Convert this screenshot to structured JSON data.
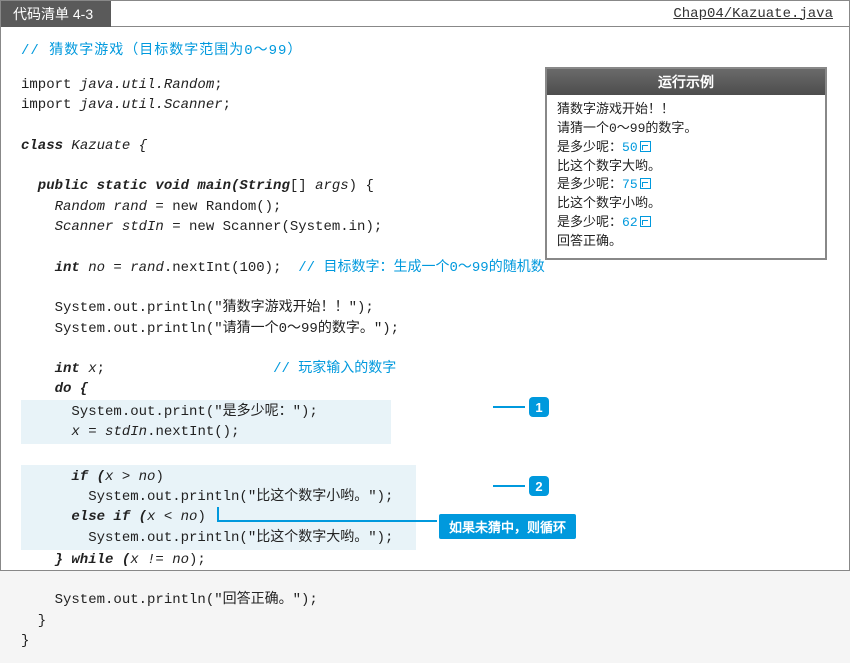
{
  "header": {
    "title_label": "代码清单 4-3",
    "file_path": "Chap04/Kazuate.java"
  },
  "top_comment": "//  猜数字游戏（目标数字范围为0～99）",
  "code": {
    "import1a": "import ",
    "import1b": "java.util.Random",
    "semi": ";",
    "import2b": "java.util.Scanner",
    "class_kw": "class",
    "class_name": " Kazuate {",
    "main_sig1": "  public static void main(String",
    "main_sig2": "[] ",
    "main_sig3": "args",
    "main_sig4": ") {",
    "rand_decl": "    Random rand",
    "rand_rest": " = new Random();",
    "scan_decl": "    Scanner stdIn",
    "scan_rest": " = new Scanner(System.in);",
    "no_decl": "    int ",
    "no_var": "no",
    "no_rest": " = ",
    "no_rand": "rand",
    "no_call": ".nextInt(100);  ",
    "no_cm": "// 目标数字：生成一个0～99的随机数",
    "out1": "    System.out.println(\"猜数字游戏开始！！\");",
    "out2": "    System.out.println(\"请猜一个0～99的数字。\");",
    "x_decl": "    int ",
    "x_var": "x",
    "x_semi": ";                    ",
    "x_cm": "// 玩家输入的数字",
    "do_kw": "    do {",
    "hl1_a": "      System.out.print(\"是多少呢：\");        ",
    "hl1_b": "      ",
    "hl1_b_var": "x",
    "hl1_b_rest": " = ",
    "hl1_b_stdin": "stdIn",
    "hl1_b_call": ".nextInt();                  ",
    "hl2_a": "      if (",
    "hl2_a_var": "x > no",
    "hl2_a_end": ")                              ",
    "hl2_b": "        System.out.println(\"比这个数字小哟。\");",
    "hl2_c": "      else if (",
    "hl2_c_var": "x < no",
    "hl2_c_end": ")                         ",
    "hl2_d": "        System.out.println(\"比这个数字大哟。\");",
    "while_line": "    } while (",
    "while_cond": "x != no",
    "while_end": ");",
    "out3": "    System.out.println(\"回答正确。\");",
    "close1": "  }",
    "close2": "}"
  },
  "badges": {
    "b1": "1",
    "b2": "2"
  },
  "note": "如果未猜中，则循环",
  "example": {
    "title": "运行示例",
    "l1": "猜数字游戏开始！！",
    "l2": "请猜一个0～99的数字。",
    "l3a": "是多少呢：",
    "l3b": "50",
    "l4": "比这个数字大哟。",
    "l5a": "是多少呢：",
    "l5b": "75",
    "l6": "比这个数字小哟。",
    "l7a": "是多少呢：",
    "l7b": "62",
    "l8": "回答正确。"
  }
}
